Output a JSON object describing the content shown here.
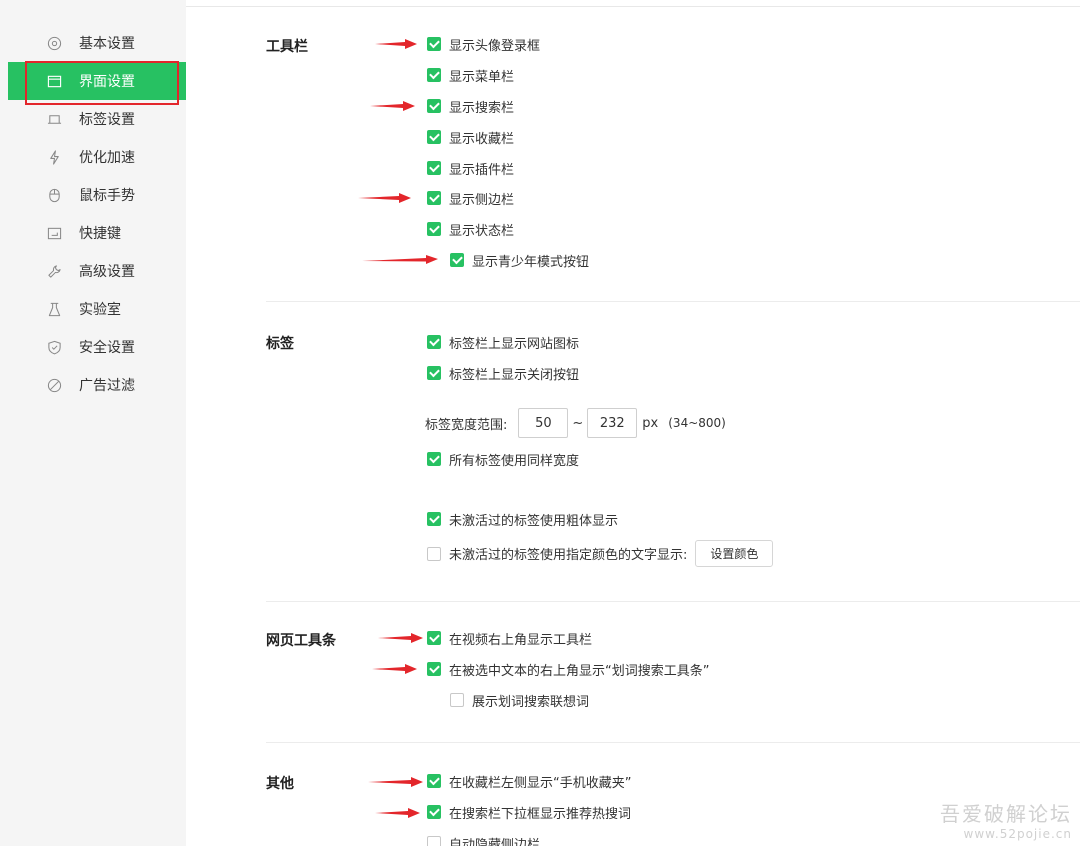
{
  "sidebar": {
    "items": [
      {
        "label": "基本设置",
        "icon": "gear-icon",
        "active": false
      },
      {
        "label": "界面设置",
        "icon": "window-icon",
        "active": true
      },
      {
        "label": "标签设置",
        "icon": "tab-icon",
        "active": false
      },
      {
        "label": "优化加速",
        "icon": "lightning-icon",
        "active": false
      },
      {
        "label": "鼠标手势",
        "icon": "mouse-icon",
        "active": false
      },
      {
        "label": "快捷键",
        "icon": "keyboard-icon",
        "active": false
      },
      {
        "label": "高级设置",
        "icon": "wrench-icon",
        "active": false
      },
      {
        "label": "实验室",
        "icon": "flask-icon",
        "active": false
      },
      {
        "label": "安全设置",
        "icon": "shield-icon",
        "active": false
      },
      {
        "label": "广告过滤",
        "icon": "block-icon",
        "active": false
      }
    ]
  },
  "toolbar_section": {
    "title": "工具栏",
    "options": [
      {
        "label": "显示头像登录框",
        "checked": true
      },
      {
        "label": "显示菜单栏",
        "checked": true
      },
      {
        "label": "显示搜索栏",
        "checked": true
      },
      {
        "label": "显示收藏栏",
        "checked": true
      },
      {
        "label": "显示插件栏",
        "checked": true
      },
      {
        "label": "显示侧边栏",
        "checked": true
      },
      {
        "label": "显示状态栏",
        "checked": true
      },
      {
        "label": "显示青少年模式按钮",
        "checked": true
      }
    ]
  },
  "tabs_section": {
    "title": "标签",
    "options": [
      {
        "label": "标签栏上显示网站图标",
        "checked": true
      },
      {
        "label": "标签栏上显示关闭按钮",
        "checked": true
      }
    ],
    "width_range": {
      "label": "标签宽度范围:",
      "min": "50",
      "separator": "~",
      "max": "232",
      "unit": "px",
      "hint": "(34~800)"
    },
    "same_width": {
      "label": "所有标签使用同样宽度",
      "checked": true
    },
    "bold_inactive": {
      "label": "未激活过的标签使用粗体显示",
      "checked": true
    },
    "color_inactive": {
      "label": "未激活过的标签使用指定颜色的文字显示:",
      "checked": false
    },
    "set_color_button": "设置颜色"
  },
  "webpage_toolbar_section": {
    "title": "网页工具条",
    "options": [
      {
        "label": "在视频右上角显示工具栏",
        "checked": true
      },
      {
        "label": "在被选中文本的右上角显示“划词搜索工具条”",
        "checked": true
      },
      {
        "label": "展示划词搜索联想词",
        "checked": false
      }
    ]
  },
  "other_section": {
    "title": "其他",
    "options": [
      {
        "label": "在收藏栏左侧显示“手机收藏夹”",
        "checked": true
      },
      {
        "label": "在搜索栏下拉框显示推荐热搜词",
        "checked": true
      },
      {
        "label": "自动隐藏侧边栏",
        "checked": false
      }
    ]
  },
  "watermark": {
    "text": "吾爱破解论坛",
    "url": "www.52pojie.cn"
  },
  "colors": {
    "accent": "#27c162",
    "highlight": "#e3262b",
    "sidebar_bg": "#f5f5f5"
  }
}
